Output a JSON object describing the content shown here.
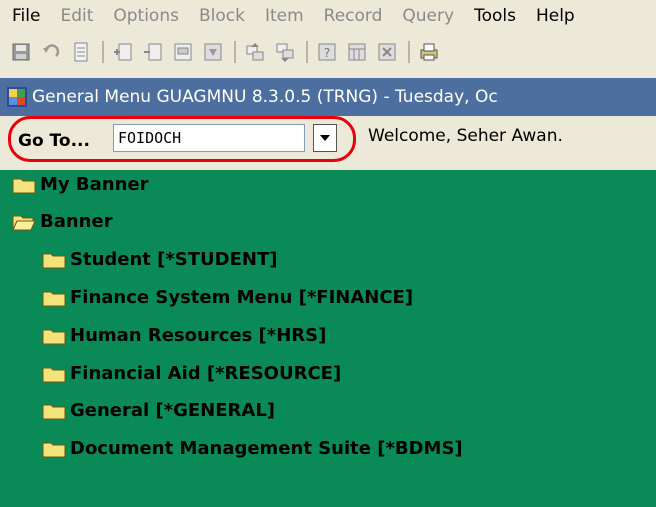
{
  "menu": [
    {
      "label": "File",
      "enabled": true
    },
    {
      "label": "Edit",
      "enabled": false
    },
    {
      "label": "Options",
      "enabled": false
    },
    {
      "label": "Block",
      "enabled": false
    },
    {
      "label": "Item",
      "enabled": false
    },
    {
      "label": "Record",
      "enabled": false
    },
    {
      "label": "Query",
      "enabled": false
    },
    {
      "label": "Tools",
      "enabled": true
    },
    {
      "label": "Help",
      "enabled": true
    }
  ],
  "toolbar_icons": [
    "save-icon",
    "rollback-icon",
    "document-icon",
    "insert-record-icon",
    "remove-record-icon",
    "enter-query-icon",
    "execute-query-icon",
    "previous-block-icon",
    "next-block-icon",
    "help-icon",
    "calendar-icon",
    "cancel-icon",
    "print-icon"
  ],
  "window": {
    "title": "General Menu  GUAGMNU  8.3.0.5  (TRNG) - Tuesday, Oc"
  },
  "goto": {
    "label": "Go To...",
    "value": "FOIDOCH"
  },
  "welcome": "Welcome, Seher Awan.",
  "tree": [
    {
      "label": "My Banner",
      "level": 0,
      "open": false
    },
    {
      "label": "Banner",
      "level": 0,
      "open": true
    },
    {
      "label": "Student [*STUDENT]",
      "level": 1,
      "open": false
    },
    {
      "label": "Finance System Menu [*FINANCE]",
      "level": 1,
      "open": false
    },
    {
      "label": "Human Resources [*HRS]",
      "level": 1,
      "open": false
    },
    {
      "label": "Financial Aid [*RESOURCE]",
      "level": 1,
      "open": false
    },
    {
      "label": "General [*GENERAL]",
      "level": 1,
      "open": false
    },
    {
      "label": "Document Management Suite [*BDMS]",
      "level": 1,
      "open": false
    }
  ],
  "colors": {
    "tree_background": "#0a8a57",
    "title_bar": "#4d6f9f",
    "highlight": "#e8000b",
    "folder": "#f5e27a"
  }
}
